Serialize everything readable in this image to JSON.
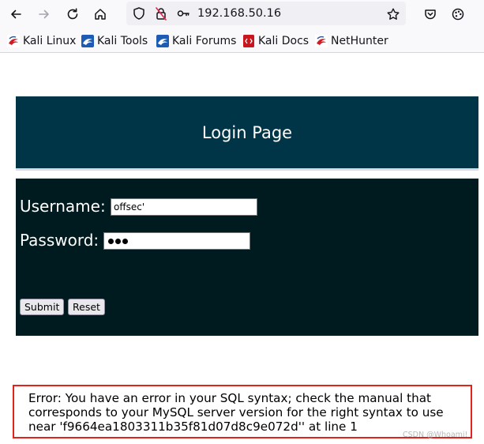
{
  "browser": {
    "url": "192.168.50.16",
    "bookmarks": [
      {
        "label": "Kali Linux",
        "icon": "kali-dragon-icon"
      },
      {
        "label": "Kali Tools",
        "icon": "kali-dragon-icon"
      },
      {
        "label": "Kali Forums",
        "icon": "kali-dragon-icon"
      },
      {
        "label": "Kali Docs",
        "icon": "kali-docs-icon"
      },
      {
        "label": "NetHunter",
        "icon": "kali-dragon-icon"
      }
    ],
    "icons": [
      "back-arrow-icon",
      "forward-arrow-icon",
      "reload-icon",
      "home-icon",
      "shield-icon",
      "insecure-lock-icon",
      "key-icon",
      "star-icon",
      "pocket-icon",
      "extensions-icon"
    ]
  },
  "page": {
    "title": "Login Page",
    "username_label": "Username:",
    "username_value": "offsec'",
    "password_label": "Password:",
    "password_length": 3,
    "submit_label": "Submit",
    "reset_label": "Reset",
    "error_message": "Error: You have an error in your SQL syntax; check the manual that corresponds to your MySQL server version for the right syntax to use near 'f9664ea1803311b35f81d07d8c9e072d'' at line 1"
  },
  "watermark": "CSDN @Whoami!",
  "colors": {
    "header_bg": "#003547",
    "panel_bg": "#001b1f",
    "error_border": "#e2231a"
  }
}
